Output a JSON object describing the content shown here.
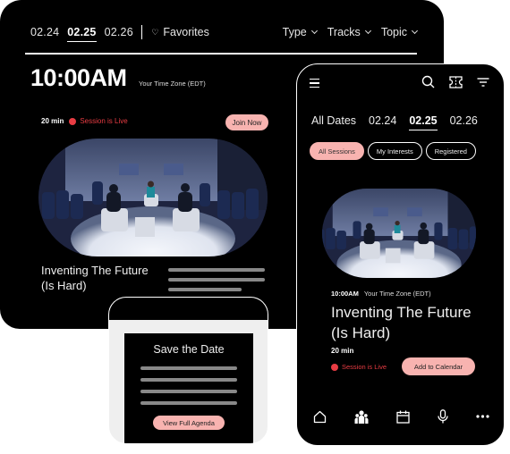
{
  "tablet": {
    "dates": [
      {
        "label": "02.24",
        "active": false
      },
      {
        "label": "02.25",
        "active": true
      },
      {
        "label": "02.26",
        "active": false
      }
    ],
    "favorites_label": "Favorites",
    "filters": [
      "Type",
      "Tracks",
      "Topic"
    ],
    "time": "10:00AM",
    "timezone": "Your Time Zone (EDT)",
    "duration": "20 min",
    "status": "Session is Live",
    "join_label": "Join Now",
    "session_title": "Inventing The Future (Is Hard)",
    "image_alt": "Panel discussion on a round stage with audience"
  },
  "email": {
    "title": "Save the Date",
    "button_label": "View Full Agenda"
  },
  "phone": {
    "dates": [
      {
        "label": "All Dates",
        "active": false
      },
      {
        "label": "02.24",
        "active": false
      },
      {
        "label": "02.25",
        "active": true
      },
      {
        "label": "02.26",
        "active": false
      }
    ],
    "chips": [
      {
        "label": "All Sessions",
        "active": true
      },
      {
        "label": "My Interests",
        "active": false
      },
      {
        "label": "Registered",
        "active": false
      }
    ],
    "time": "10:00AM",
    "timezone": "Your Time Zone (EDT)",
    "session_title": "Inventing The Future (Is Hard)",
    "duration": "20 min",
    "status": "Session is Live",
    "calendar_label": "Add to Calendar",
    "header_icons": [
      "menu-icon",
      "search-icon",
      "ticket-icon",
      "filter-icon"
    ],
    "tabbar_icons": [
      "home-icon",
      "people-icon",
      "calendar-icon",
      "microphone-icon",
      "more-icon"
    ]
  },
  "colors": {
    "accent_pink": "#f8b3b0",
    "live_red": "#e83c43",
    "background": "#000000"
  }
}
